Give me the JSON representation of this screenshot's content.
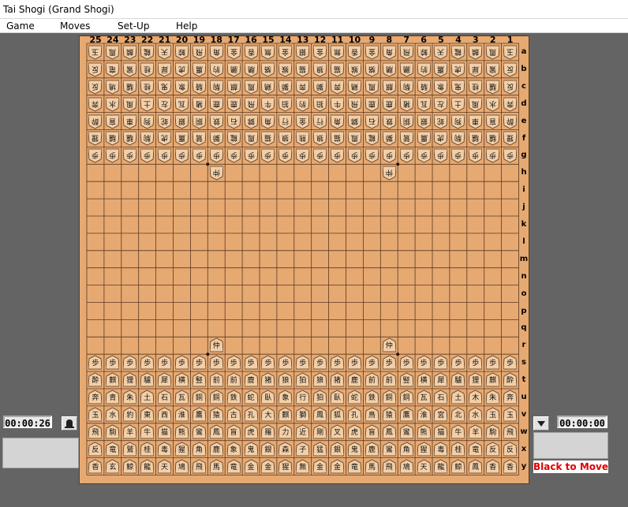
{
  "window": {
    "title": "Tai Shogi  (Grand Shogi)"
  },
  "menu": [
    "Game",
    "Moves",
    "Set-Up",
    "Help"
  ],
  "board": {
    "files": [
      "25",
      "24",
      "23",
      "22",
      "21",
      "20",
      "19",
      "18",
      "17",
      "16",
      "15",
      "14",
      "13",
      "12",
      "11",
      "10",
      "9",
      "8",
      "7",
      "6",
      "5",
      "4",
      "3",
      "2",
      "1"
    ],
    "ranks": [
      "a",
      "b",
      "c",
      "d",
      "e",
      "f",
      "g",
      "h",
      "i",
      "j",
      "k",
      "l",
      "m",
      "n",
      "o",
      "p",
      "q",
      "r",
      "s",
      "t",
      "u",
      "v",
      "w",
      "x",
      "y"
    ],
    "colors": {
      "board": "#e6a972",
      "piece": "#f2cfa8",
      "piece_outline": "#5a3a20",
      "line": "#5b3a20"
    },
    "gote_pieces": [
      [
        "玉",
        "鳳",
        "麟",
        "龍",
        "天",
        "鯨",
        "飛",
        "角",
        "金",
        "香",
        "無",
        "金",
        "銀",
        "金",
        "無",
        "香",
        "金",
        "角",
        "飛",
        "鯨",
        "天",
        "龍",
        "麟",
        "鳳",
        "玉"
      ],
      [
        "反",
        "竜",
        "鸞",
        "桂",
        "犀",
        "虎",
        "鷹",
        "豹",
        "鵬",
        "鵰",
        "貉",
        "猴",
        "猫",
        "狼",
        "猫",
        "猴",
        "貉",
        "鵰",
        "鵬",
        "豹",
        "鷹",
        "虎",
        "犀",
        "鸞",
        "反"
      ],
      [
        "反",
        "鳩",
        "驢",
        "桂",
        "鬼",
        "象",
        "騎",
        "駒",
        "麒",
        "鳳",
        "鶏",
        "獅",
        "奔",
        "獅",
        "奔",
        "鶏",
        "鳳",
        "麒",
        "駒",
        "騎",
        "象",
        "鬼",
        "桂",
        "驢",
        "反"
      ],
      [
        "奔",
        "水",
        "風",
        "土",
        "左",
        "瓦",
        "猪",
        "鹿",
        "鹿",
        "飛",
        "牛",
        "狛",
        "豹",
        "狛",
        "牛",
        "飛",
        "鹿",
        "鹿",
        "猪",
        "瓦",
        "左",
        "土",
        "風",
        "水",
        "奔"
      ],
      [
        "酔",
        "盲",
        "車",
        "狗",
        "蛇",
        "銀",
        "銅",
        "鉄",
        "石",
        "錦",
        "角",
        "行",
        "金",
        "行",
        "角",
        "錦",
        "石",
        "鉄",
        "銅",
        "銀",
        "蛇",
        "狗",
        "車",
        "盲",
        "酔"
      ],
      [
        "狸",
        "驢",
        "驢",
        "駒",
        "虎",
        "鷹",
        "鷲",
        "獅",
        "龍",
        "鳳",
        "猫",
        "狼",
        "熊",
        "狼",
        "猫",
        "鳳",
        "龍",
        "獅",
        "鷲",
        "鷹",
        "虎",
        "駒",
        "驢",
        "驢",
        "狸"
      ],
      [
        "歩",
        "歩",
        "歩",
        "歩",
        "歩",
        "歩",
        "歩",
        "歩",
        "歩",
        "歩",
        "歩",
        "歩",
        "歩",
        "歩",
        "歩",
        "歩",
        "歩",
        "歩",
        "歩",
        "歩",
        "歩",
        "歩",
        "歩",
        "歩",
        "歩"
      ]
    ],
    "gote_extra": [
      {
        "file": "18",
        "rank": "h",
        "label": "仲"
      },
      {
        "file": "8",
        "rank": "h",
        "label": "仲"
      }
    ],
    "sente_extra": [
      {
        "file": "18",
        "rank": "r",
        "label": "仲"
      },
      {
        "file": "8",
        "rank": "r",
        "label": "仲"
      }
    ],
    "sente_pieces": [
      [
        "歩",
        "歩",
        "歩",
        "歩",
        "歩",
        "歩",
        "歩",
        "歩",
        "歩",
        "歩",
        "歩",
        "歩",
        "歩",
        "歩",
        "歩",
        "歩",
        "歩",
        "歩",
        "歩",
        "歩",
        "歩",
        "歩",
        "歩",
        "歩",
        "歩"
      ],
      [
        "酔",
        "麒",
        "狸",
        "驢",
        "犀",
        "横",
        "竪",
        "前",
        "前",
        "鹿",
        "猪",
        "狼",
        "狛",
        "狼",
        "猪",
        "鹿",
        "前",
        "前",
        "竪",
        "横",
        "犀",
        "驢",
        "狸",
        "麒",
        "酔"
      ],
      [
        "奔",
        "青",
        "朱",
        "土",
        "石",
        "瓦",
        "銅",
        "銅",
        "鉄",
        "蛇",
        "臥",
        "象",
        "行",
        "狛",
        "臥",
        "蛇",
        "鉄",
        "銅",
        "銅",
        "瓦",
        "石",
        "土",
        "木",
        "朱",
        "奔"
      ],
      [
        "玉",
        "水",
        "豹",
        "東",
        "西",
        "淮",
        "鷹",
        "猿",
        "古",
        "孔",
        "大",
        "麒",
        "獅",
        "鳳",
        "狐",
        "孔",
        "鳥",
        "猿",
        "鷹",
        "淮",
        "宮",
        "北",
        "水",
        "玉",
        "玉"
      ],
      [
        "飛",
        "駒",
        "羊",
        "牛",
        "猫",
        "熊",
        "鸞",
        "鳳",
        "盲",
        "虎",
        "羅",
        "力",
        "近",
        "剛",
        "叉",
        "虎",
        "盲",
        "鳳",
        "鸞",
        "熊",
        "猫",
        "牛",
        "羊",
        "駒",
        "飛"
      ],
      [
        "反",
        "竜",
        "鷲",
        "桂",
        "毒",
        "猩",
        "角",
        "鹿",
        "象",
        "鬼",
        "銀",
        "森",
        "子",
        "猛",
        "銀",
        "鬼",
        "鹿",
        "鸞",
        "角",
        "猩",
        "毒",
        "桂",
        "竜",
        "反",
        "反"
      ],
      [
        "香",
        "玄",
        "鯨",
        "龍",
        "天",
        "鳩",
        "飛",
        "馬",
        "竜",
        "金",
        "金",
        "猩",
        "無",
        "金",
        "金",
        "竜",
        "馬",
        "飛",
        "鳩",
        "天",
        "龍",
        "鯨",
        "鳳",
        "香",
        "香"
      ]
    ]
  },
  "left_clock": "00:00:26",
  "right_clock": "00:00:00",
  "status": "Black to Move"
}
